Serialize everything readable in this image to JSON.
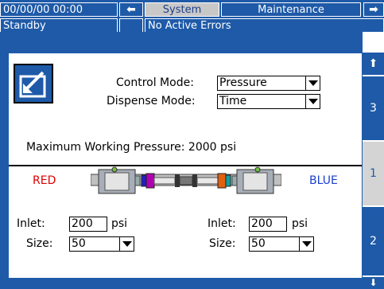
{
  "header": {
    "datetime": "00/00/00 00:00",
    "tab_system": "System",
    "tab_maintenance": "Maintenance",
    "status": "Standby",
    "errors": "No Active Errors"
  },
  "sidebar": {
    "tabs": [
      "3",
      "1",
      "2"
    ]
  },
  "controls": {
    "control_mode_label": "Control Mode:",
    "control_mode_value": "Pressure",
    "dispense_mode_label": "Dispense Mode:",
    "dispense_mode_value": "Time",
    "max_pressure_text": "Maximum Working Pressure: 2000 psi"
  },
  "pumps": {
    "left_label": "RED",
    "right_label": "BLUE",
    "left": {
      "inlet_label": "Inlet:",
      "inlet_value": "200",
      "inlet_unit": "psi",
      "size_label": "Size:",
      "size_value": "50"
    },
    "right": {
      "inlet_label": "Inlet:",
      "inlet_value": "200",
      "inlet_unit": "psi",
      "size_label": "Size:",
      "size_value": "50"
    }
  },
  "colors": {
    "brand": "#1e5aa8",
    "red": "#e00000",
    "blue": "#1a3fd0"
  }
}
